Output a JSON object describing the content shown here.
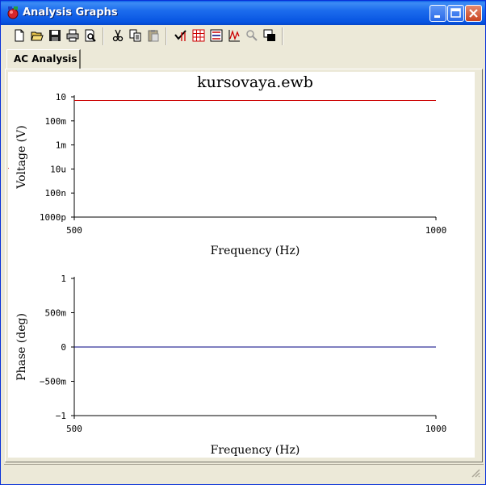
{
  "window": {
    "title": "Analysis Graphs",
    "title_color": "#ffffff",
    "titlebar_color": "#0754e1"
  },
  "toolbar": {
    "buttons": [
      {
        "name": "new-icon"
      },
      {
        "name": "open-icon"
      },
      {
        "name": "save-icon"
      },
      {
        "name": "print-icon"
      },
      {
        "name": "print-preview-icon"
      },
      {
        "name": "cut-icon"
      },
      {
        "name": "copy-icon"
      },
      {
        "name": "paste-icon"
      },
      {
        "name": "toggle-cursors-icon"
      },
      {
        "name": "toggle-grid-icon"
      },
      {
        "name": "toggle-legend-icon"
      },
      {
        "name": "graph-properties-icon"
      },
      {
        "name": "zoom-icon"
      },
      {
        "name": "restore-view-icon"
      }
    ]
  },
  "tabs": [
    {
      "label": "AC Analysis",
      "active": true
    }
  ],
  "chart_data": [
    {
      "type": "line",
      "title": "kursovaya.ewb",
      "xlabel": "Frequency (Hz)",
      "ylabel": "Voltage (V)",
      "xlim": [
        500,
        1000
      ],
      "x_ticks": [
        "500",
        "1000"
      ],
      "yscale": "log",
      "y_ticks": [
        "10",
        "100m",
        "1m",
        "10u",
        "100n",
        "1000p"
      ],
      "y_tick_values": [
        10,
        0.1,
        0.001,
        1e-05,
        1e-07,
        1e-09
      ],
      "ylim": [
        1e-09,
        10
      ],
      "grid": false,
      "series": [
        {
          "color": "#cc0000",
          "x": [
            500,
            1000
          ],
          "y": [
            5,
            5
          ]
        }
      ],
      "cursor_marker_color": "#cc0000"
    },
    {
      "type": "line",
      "title": "",
      "xlabel": "Frequency (Hz)",
      "ylabel": "Phase (deg)",
      "xlim": [
        500,
        1000
      ],
      "x_ticks": [
        "500",
        "1000"
      ],
      "yscale": "linear",
      "y_ticks": [
        "1",
        "500m",
        "0",
        "−500m",
        "−1"
      ],
      "y_tick_values": [
        1,
        0.5,
        0,
        -0.5,
        -1
      ],
      "ylim": [
        -1,
        1
      ],
      "grid": false,
      "series": [
        {
          "color": "#000080",
          "x": [
            500,
            1000
          ],
          "y": [
            0,
            0
          ]
        }
      ]
    }
  ]
}
